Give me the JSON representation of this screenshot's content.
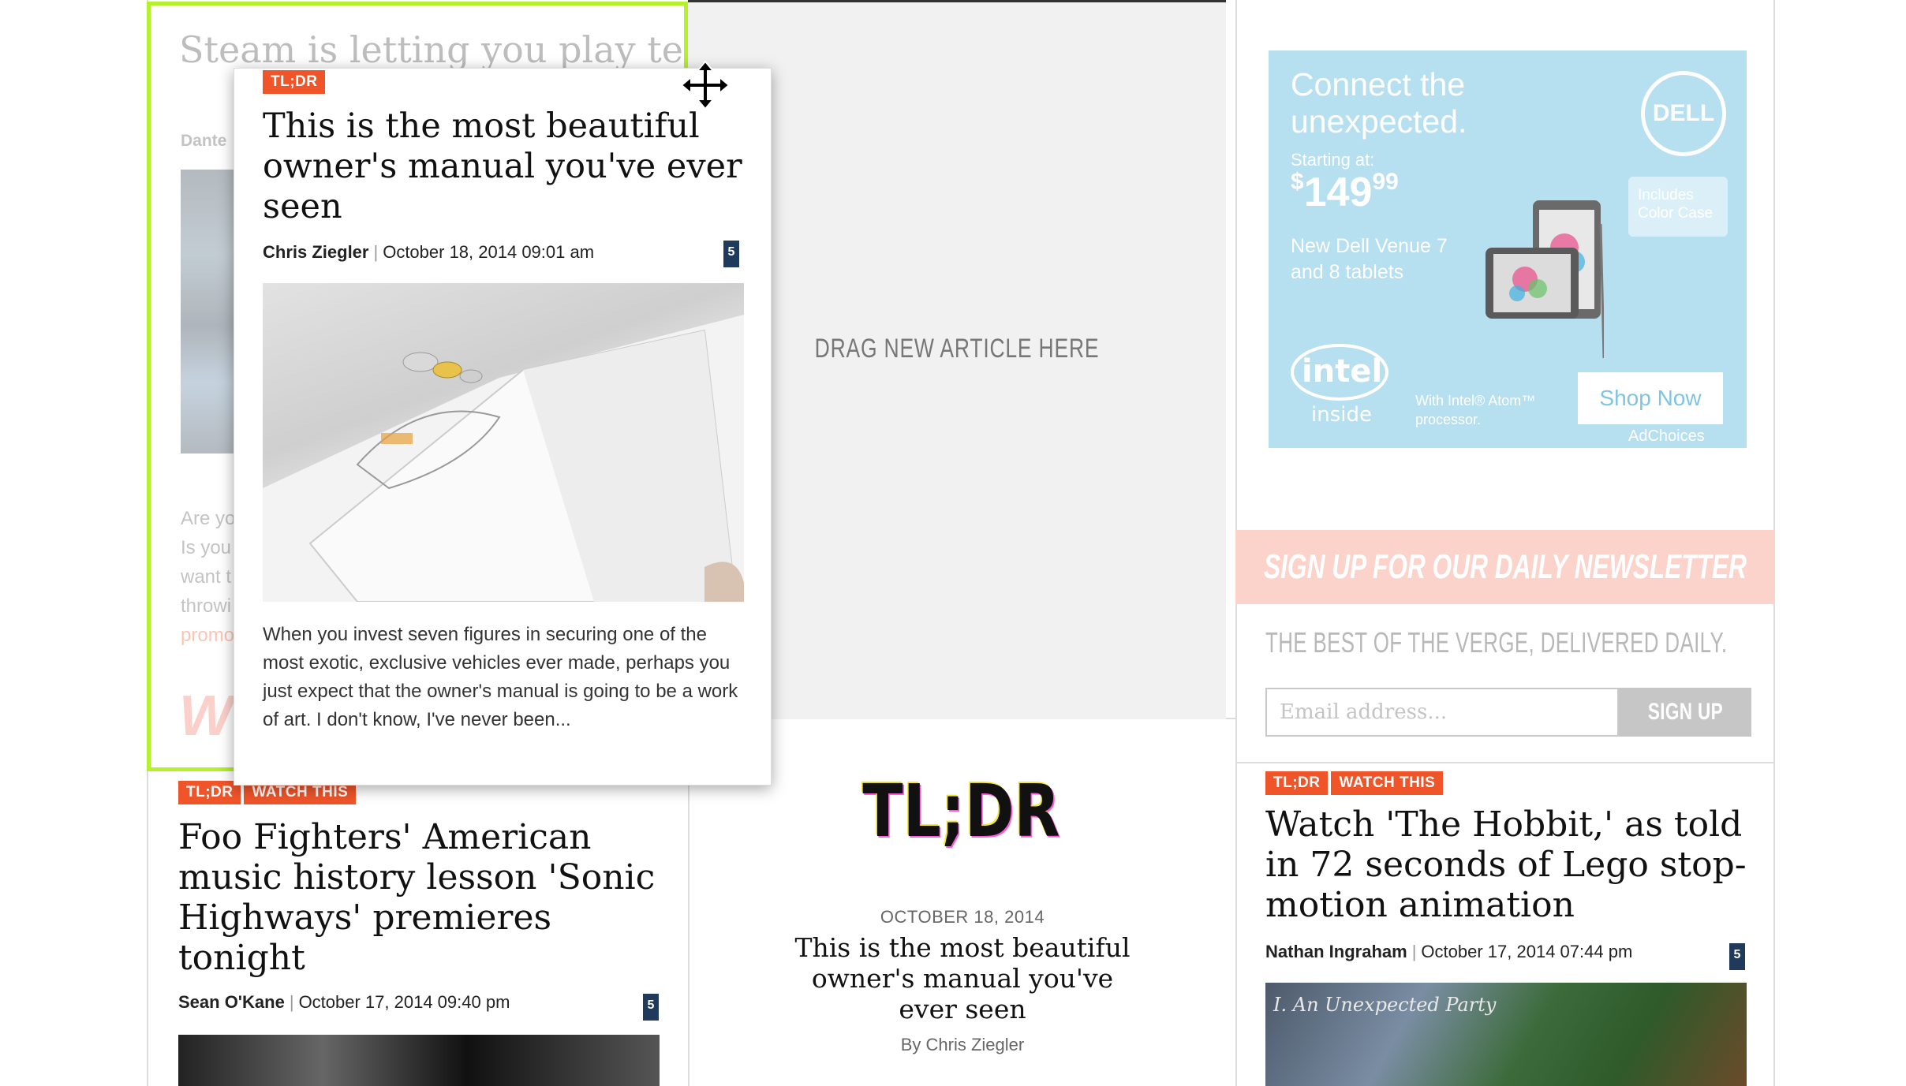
{
  "left_article": {
    "title": "Steam is letting you play ten gar",
    "author": "Dante",
    "excerpt_lines": [
      "Are yo",
      "Is you",
      "want t",
      "throwi"
    ],
    "excerpt_link": "promo",
    "big_text": "WE"
  },
  "drop_zone": {
    "label": "DRAG NEW ARTICLE HERE"
  },
  "dragged_card": {
    "tag": "TL;DR",
    "title": "This is the most beautiful owner's manual you've ever seen",
    "author": "Chris Ziegler",
    "date": "October 18, 2014 09:01 am",
    "comments": "5",
    "excerpt": "When you invest seven figures in securing one of the most exotic, exclusive vehicles ever made, perhaps you just expect that the owner's manual is going to be a work of art. I don't know, I've never been..."
  },
  "foo_article": {
    "tags": [
      "TL;DR",
      "WATCH THIS"
    ],
    "title": "Foo Fighters' American music history lesson 'Sonic Highways' premieres tonight",
    "author": "Sean O'Kane",
    "date": "October 17, 2014 09:40 pm",
    "comments": "5"
  },
  "tldr_feature": {
    "logo": "TL;DR",
    "date": "OCTOBER 18, 2014",
    "title": "This is the most beautiful owner's manual you've ever seen",
    "byline": "By Chris Ziegler"
  },
  "ad": {
    "headline_line1": "Connect the",
    "headline_line2": "unexpected.",
    "starting": "Starting at:",
    "price_symbol": "$",
    "price_main": "149",
    "price_cents": "99",
    "product_line1": "New Dell Venue 7",
    "product_line2": "and 8 tablets",
    "brand": "DELL",
    "includes_line1": "Includes",
    "includes_line2": "Color Case",
    "intel_word": "intel",
    "intel_inside": "inside",
    "processor_line1": "With Intel® Atom™",
    "processor_line2": "processor.",
    "cta": "Shop Now",
    "adchoices": "AdChoices"
  },
  "newsletter": {
    "banner": "SIGN UP FOR OUR DAILY NEWSLETTER",
    "tagline": "THE BEST OF THE VERGE, DELIVERED DAILY.",
    "email_placeholder": "Email address...",
    "button": "SIGN UP"
  },
  "hobbit_article": {
    "tags": [
      "TL;DR",
      "WATCH THIS"
    ],
    "title": "Watch 'The Hobbit,' as told in 72 seconds of Lego stop-motion animation",
    "author": "Nathan Ingraham",
    "date": "October 17, 2014 07:44 pm",
    "comments": "5",
    "image_caption": "I. An Unexpected Party"
  },
  "colors": {
    "accent_orange": "#f0552a",
    "highlight_green": "#b4f02b",
    "comment_badge": "#1f3a5a",
    "newsletter_pink": "#fbd3cb",
    "ad_blue": "#b6dff0"
  }
}
